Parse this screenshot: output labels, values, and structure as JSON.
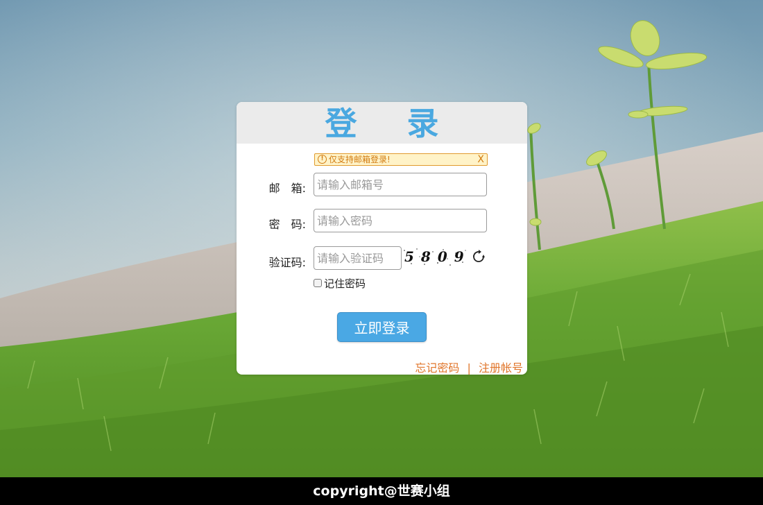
{
  "login": {
    "title": "登 录",
    "notice": {
      "icon": "info-icon",
      "text": "仅支持邮箱登录!",
      "close": "X"
    },
    "email": {
      "label": "邮　箱:",
      "placeholder": "请输入邮箱号",
      "value": ""
    },
    "password": {
      "label": "密　码:",
      "placeholder": "请输入密码",
      "value": ""
    },
    "captcha": {
      "label": "验证码:",
      "placeholder": "请输入验证码",
      "value": "",
      "code": "5809",
      "refresh_icon": "refresh-icon"
    },
    "remember": {
      "label": "记住密码",
      "checked": false
    },
    "submit_label": "立即登录",
    "forgot_label": "忘记密码",
    "separator": "|",
    "register_label": "注册帐号"
  },
  "footer": {
    "copyright": "copyright@世赛小组"
  },
  "colors": {
    "title": "#4aa8e0",
    "button": "#4aa8e4",
    "link": "#e0752a",
    "notice_border": "#e09a2d",
    "notice_bg": "#fff3c8",
    "footer_bg": "#000000"
  }
}
